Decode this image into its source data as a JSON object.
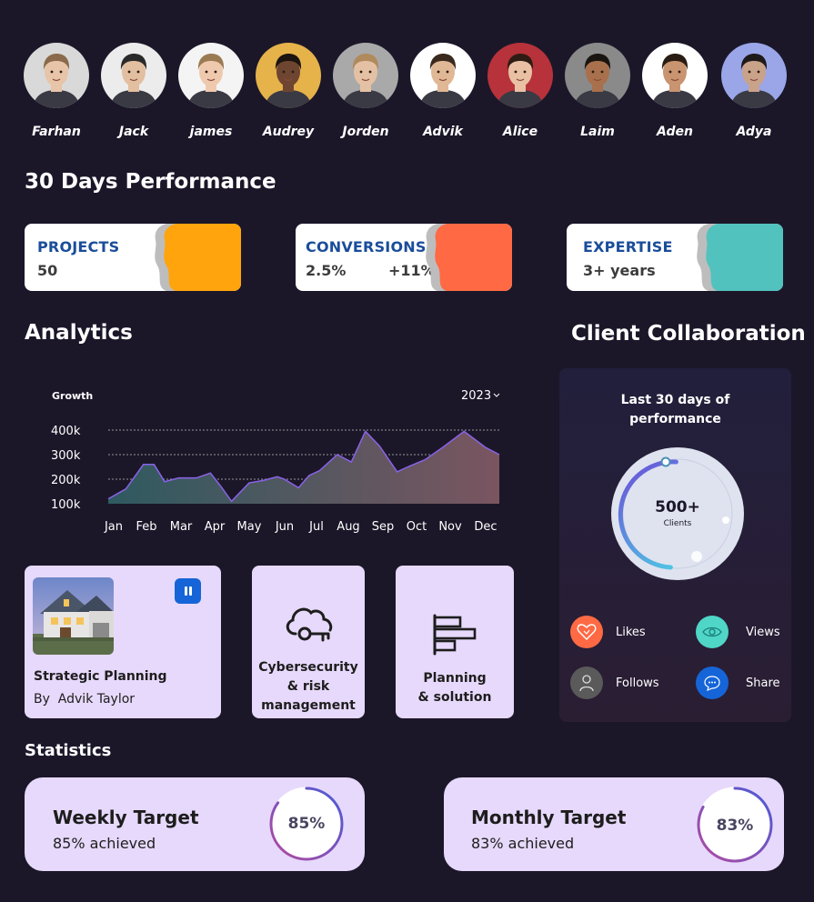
{
  "people": [
    {
      "name": "Farhan",
      "skin": "#e8c4a8",
      "hair": "#8a6a4a",
      "bg": "#d9d9d9"
    },
    {
      "name": "Jack",
      "skin": "#e2bfa0",
      "hair": "#2a2a2a",
      "bg": "#ececec"
    },
    {
      "name": "james",
      "skin": "#efc9ae",
      "hair": "#9b7a52",
      "bg": "#f4f4f4"
    },
    {
      "name": "Audrey",
      "skin": "#6e4530",
      "hair": "#1c1410",
      "bg": "#e6b24a"
    },
    {
      "name": "Jorden",
      "skin": "#e4c1a4",
      "hair": "#b08a5c",
      "bg": "#a9a9a9"
    },
    {
      "name": "Advik",
      "skin": "#e0b896",
      "hair": "#3a2a1e",
      "bg": "#ffffff"
    },
    {
      "name": "Alice",
      "skin": "#e9c0a4",
      "hair": "#2e1c14",
      "bg": "#b7323a"
    },
    {
      "name": "Laim",
      "skin": "#a8704c",
      "hair": "#1a1410",
      "bg": "#8a8a8a"
    },
    {
      "name": "Aden",
      "skin": "#c99470",
      "hair": "#2a1c12",
      "bg": "#ffffff"
    },
    {
      "name": "Adya",
      "skin": "#c9a28a",
      "hair": "#1e1a1a",
      "bg": "#9aa6e8"
    }
  ],
  "performance": {
    "title": "30 Days Performance",
    "cards": [
      {
        "label": "PROJECTS",
        "value": "50",
        "value2": "",
        "color": "#ffa40c"
      },
      {
        "label": "CONVERSIONS",
        "value": "2.5%",
        "value2": "+11%",
        "color": "#ff6a44"
      },
      {
        "label": "EXPERTISE",
        "value": "3+ years",
        "value2": "",
        "color": "#52c2be"
      }
    ]
  },
  "analytics": {
    "title": "Analytics",
    "chart_data": {
      "type": "area",
      "title": "Growth",
      "year": "2023",
      "ytick_labels": [
        "400k",
        "300k",
        "200k",
        "100k"
      ],
      "yticks": [
        400,
        300,
        200,
        100
      ],
      "ylim": [
        100,
        400
      ],
      "categories": [
        "Jan",
        "Feb",
        "Mar",
        "Apr",
        "May",
        "Jun",
        "Jul",
        "Aug",
        "Sep",
        "Oct",
        "Nov",
        "Dec"
      ],
      "x": [
        0,
        0.5,
        1,
        1.3,
        1.6,
        2,
        2.5,
        2.9,
        3.2,
        3.5,
        4.0,
        4.4,
        4.8,
        5.0,
        5.4,
        5.7,
        6.0,
        6.5,
        6.9,
        7.3,
        7.7,
        8.2,
        8.5,
        9.0,
        9.5,
        10.1,
        10.7,
        11.1
      ],
      "values": [
        120,
        160,
        260,
        260,
        190,
        205,
        205,
        225,
        170,
        110,
        185,
        195,
        210,
        200,
        165,
        215,
        235,
        300,
        270,
        395,
        335,
        230,
        250,
        280,
        330,
        395,
        330,
        300
      ],
      "grid": true,
      "colors": {
        "line": "#8a63e8",
        "fill_left": "#2e5a60",
        "fill_right": "#7a5560"
      }
    }
  },
  "collab": {
    "title": "Client Collaboration",
    "panel_title_line1": "Last 30 days of",
    "panel_title_line2": "performance",
    "big_value": "500+",
    "big_label": "Clients",
    "metrics": [
      {
        "label": "Likes",
        "icon": "heart-icon",
        "color": "#ff6a44"
      },
      {
        "label": "Views",
        "icon": "eye-icon",
        "color": "#4fd6c6"
      },
      {
        "label": "Follows",
        "icon": "user-icon",
        "color": "#5a5a5a"
      },
      {
        "label": "Share",
        "icon": "chat-icon",
        "color": "#1565d8"
      }
    ]
  },
  "features": {
    "card1_title": "Strategic Planning",
    "card1_by": "By",
    "card1_author": "Advik Taylor",
    "card2_line1": "Cybersecurity",
    "card2_line2": "& risk",
    "card2_line3": "management",
    "card3_line1": "Planning",
    "card3_line2": "& solution"
  },
  "statistics": {
    "title": "Statistics",
    "items": [
      {
        "title": "Weekly Target",
        "sub": "85% achieved",
        "pct_label": "85%",
        "pct": 0.85
      },
      {
        "title": "Monthly Target",
        "sub": "83% achieved",
        "pct_label": "83%",
        "pct": 0.83
      }
    ]
  }
}
